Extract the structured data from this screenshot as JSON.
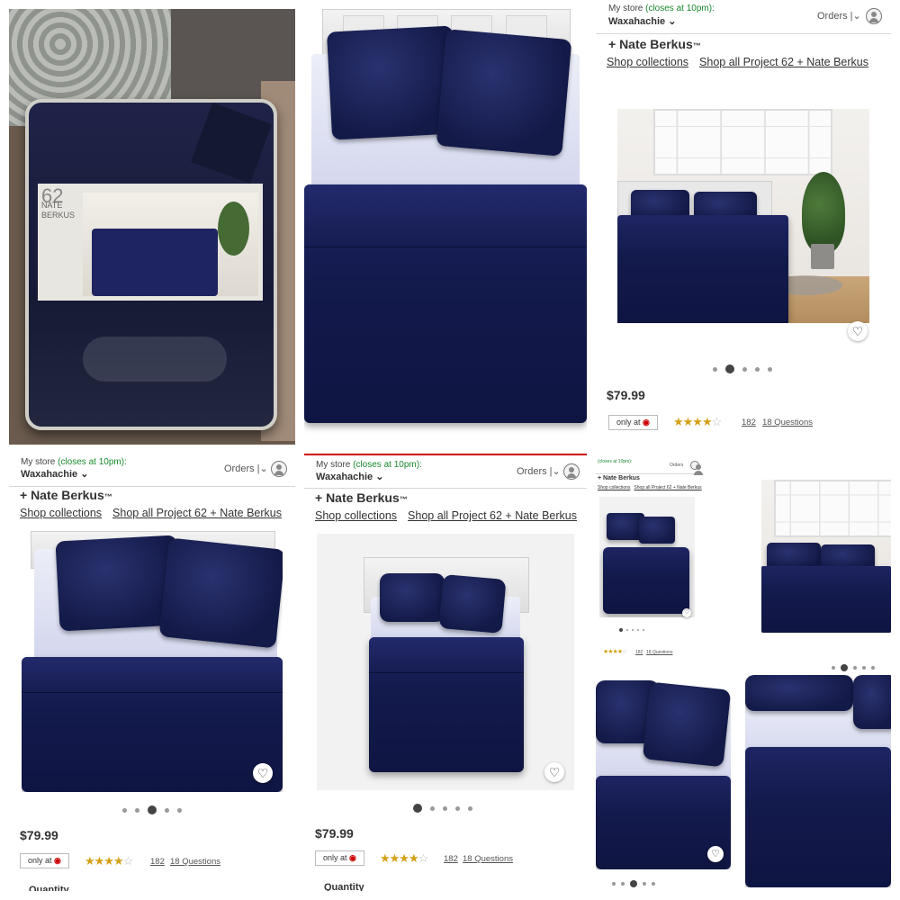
{
  "store": {
    "my_store_label": "My store",
    "closes": "(closes at 10pm):",
    "name": "Waxahachie",
    "orders": "Orders",
    "chevron": "⌄"
  },
  "product": {
    "brand": "+ Nate Berkus",
    "tm": "™",
    "shop_collections": "Shop collections",
    "shop_all": "Shop all Project 62 + Nate Berkus",
    "price": "$79.99",
    "only_at": "only at",
    "rating_count": "182",
    "questions": "18 Questions",
    "quantity": "Quantity"
  },
  "package": {
    "label_line1": "62",
    "label_line2": "NATE",
    "label_line3": "BERKUS"
  },
  "icons": {
    "heart": "♡",
    "target_bullseye": "◉",
    "star_full": "★",
    "star_empty": "☆"
  },
  "rating": {
    "value": 4,
    "max": 5
  },
  "colors": {
    "navy": "#141a48",
    "price": "#333333",
    "green": "#1a8a2e",
    "target_red": "#cc0000"
  }
}
